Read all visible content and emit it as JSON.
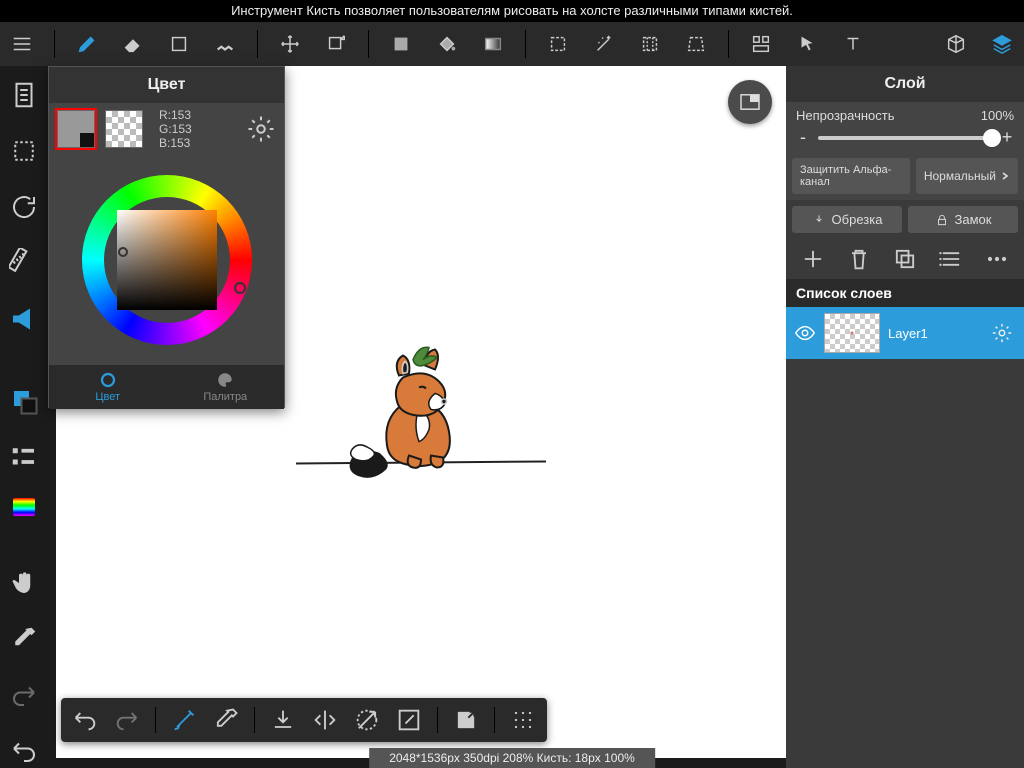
{
  "tooltip": "Инструмент Кисть позволяет пользователям рисовать на холсте различными типами кистей.",
  "topbar": {
    "icons": [
      "menu",
      "brush",
      "eraser",
      "rect-shape",
      "smudge",
      "move",
      "transform",
      "fill",
      "bucket",
      "gradient",
      "marquee",
      "wand",
      "crop",
      "perspective-crop",
      "arrange",
      "pointer",
      "text"
    ],
    "right_icons": [
      "cube-3d",
      "layers"
    ]
  },
  "leftbar": {
    "icons": [
      "document",
      "marquee-dashed",
      "refresh",
      "ruler",
      "megaphone",
      "rect-dual",
      "list-indent",
      "rainbow",
      "hand",
      "eyedropper",
      "redo-arrow",
      "undo-arrow"
    ]
  },
  "color_panel": {
    "title": "Цвет",
    "fg_swatch": "#999999",
    "rgb": {
      "r": "R:153",
      "g": "G:153",
      "b": "B:153"
    },
    "tabs": {
      "color": "Цвет",
      "palette": "Палитра"
    }
  },
  "layers": {
    "title": "Слой",
    "opacity_label": "Непрозрачность",
    "opacity_value": "100%",
    "protect_alpha": "Защитить Альфа-канал",
    "blend_mode": "Нормальный",
    "crop": "Обрезка",
    "lock": "Замок",
    "list_header": "Список слоев",
    "items": [
      {
        "name": "Layer1"
      }
    ]
  },
  "status": "2048*1536px 350dpi 208% Кисть: 18px 100%"
}
